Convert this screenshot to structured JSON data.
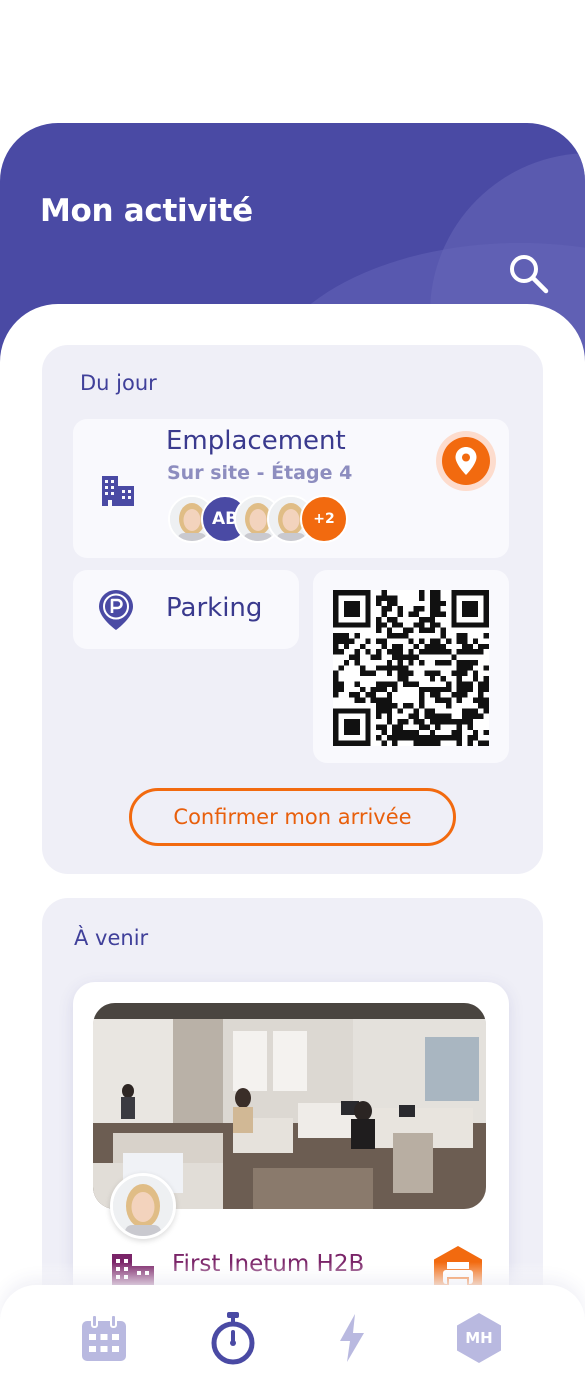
{
  "header": {
    "title": "Mon activité",
    "search_icon": "search-icon"
  },
  "today": {
    "title": "Du jour",
    "location": {
      "title": "Emplacement",
      "subtitle": "Sur site - Étage 4",
      "icon": "building-icon",
      "action_icon": "location-pin-icon",
      "attendees": [
        {
          "type": "photo"
        },
        {
          "type": "initials",
          "label": "AB"
        },
        {
          "type": "photo"
        },
        {
          "type": "photo"
        }
      ],
      "more_count": "+2"
    },
    "parking": {
      "label": "Parking",
      "icon": "parking-pin-icon"
    },
    "qr_icon": "qr-code",
    "confirm_label": "Confirmer mon arrivée"
  },
  "upcoming": {
    "title": "À venir",
    "event": {
      "title": "First Inetum H2B",
      "icon": "building-icon",
      "action_icon": "printer-icon"
    }
  },
  "nav": {
    "items": [
      "calendar-icon",
      "stopwatch-icon",
      "lightning-icon",
      "profile-avatar"
    ],
    "profile_initials": "MH"
  },
  "colors": {
    "primary": "#4a4aa4",
    "accent": "#f26a0f",
    "card_bg": "#efeff7",
    "event_title": "#7a2468"
  }
}
